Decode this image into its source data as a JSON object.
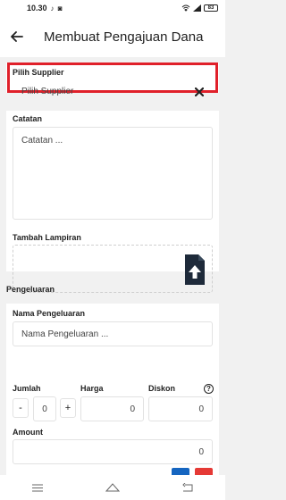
{
  "status_bar": {
    "time": "10.30",
    "left_icons": "♪ ◙",
    "battery": "83"
  },
  "app_bar": {
    "title": "Membuat Pengajuan Dana"
  },
  "supplier": {
    "label": "Pilih Supplier",
    "value": "Pilih Supplier"
  },
  "notes": {
    "label": "Catatan",
    "placeholder": "Catatan ..."
  },
  "attachment": {
    "label": "Tambah Lampiran"
  },
  "expenses": {
    "section_label": "Pengeluaran",
    "name_label": "Nama Pengeluaran",
    "name_placeholder": "Nama Pengeluaran ...",
    "qty_label": "Jumlah",
    "qty_value": "0",
    "minus": "-",
    "plus": "+",
    "price_label": "Harga",
    "price_value": "0",
    "discount_label": "Diskon",
    "discount_value": "0",
    "help": "?",
    "amount_label": "Amount",
    "amount_value": "0"
  },
  "colors": {
    "highlight": "#e0202a",
    "accent_blue": "#1565c0",
    "accent_red": "#e53935",
    "upload_icon": "#1e2a3a"
  },
  "icons": [
    "arrow-back-icon",
    "close-icon",
    "upload-file-icon",
    "help-icon",
    "menu-icon",
    "home-icon",
    "back-nav-icon"
  ]
}
